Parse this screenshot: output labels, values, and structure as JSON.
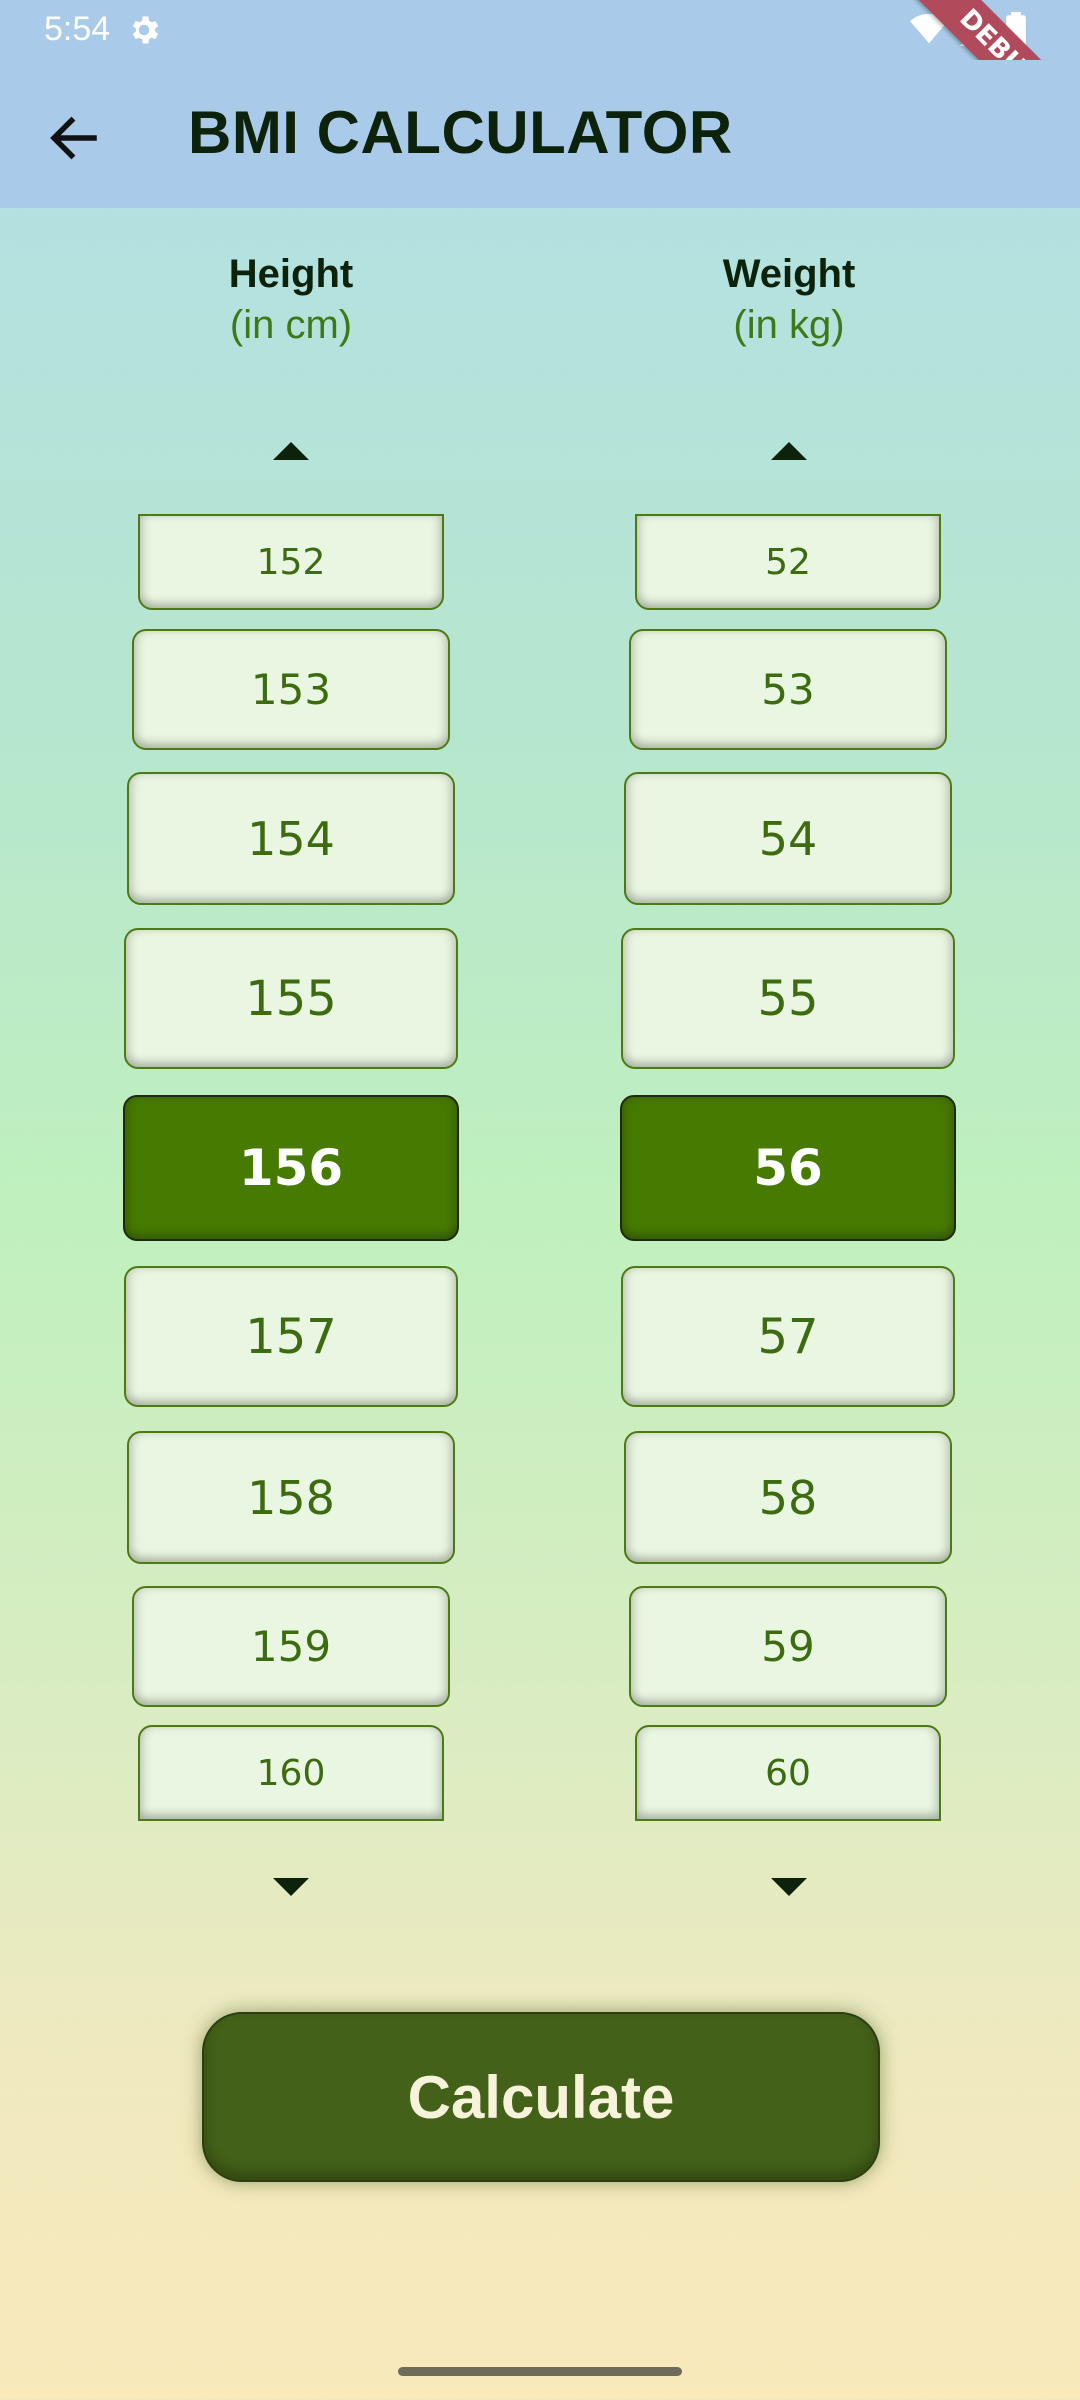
{
  "status_bar": {
    "time": "5:54"
  },
  "app_bar": {
    "title": "BMI CALCULATOR"
  },
  "debug_banner": "DEBUG",
  "height": {
    "label": "Height",
    "unit": "(in cm)",
    "values": [
      "152",
      "153",
      "154",
      "155",
      "156",
      "157",
      "158",
      "159",
      "160"
    ],
    "selected": "156"
  },
  "weight": {
    "label": "Weight",
    "unit": "(in kg)",
    "values": [
      "52",
      "53",
      "54",
      "55",
      "56",
      "57",
      "58",
      "59",
      "60"
    ],
    "selected": "56"
  },
  "calculate_label": "Calculate",
  "colors": {
    "accent": "#477a00",
    "button": "#436118",
    "text_dark": "#0d220b",
    "unit_text": "#3c7a18"
  }
}
